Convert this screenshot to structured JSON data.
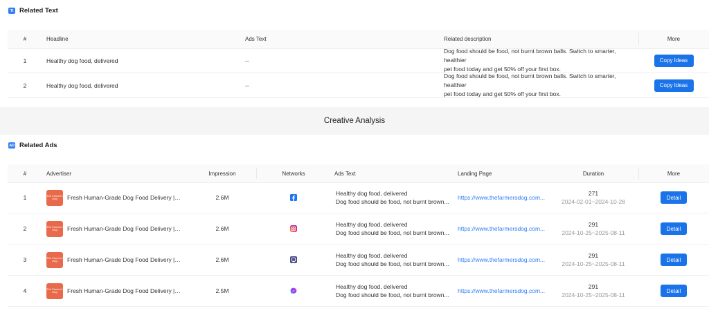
{
  "related_text": {
    "title": "Related Text",
    "badge": "Tt",
    "columns": [
      "#",
      "Headline",
      "Ads Text",
      "Related description",
      "More"
    ],
    "rows": [
      {
        "num": "1",
        "headline": "Healthy dog food, delivered",
        "ads_text": "--",
        "desc1": "Dog food should be food, not burnt brown balls. Switch to smarter, healthier",
        "desc2": "pet food today and get 50% off your first box.",
        "button": "Copy Ideas"
      },
      {
        "num": "2",
        "headline": "Healthy dog food, delivered",
        "ads_text": "--",
        "desc1": "Dog food should be food, not burnt brown balls. Switch to smarter, healthier",
        "desc2": "pet food today and get 50% off your first box.",
        "button": "Copy Ideas"
      }
    ]
  },
  "creative_analysis": {
    "title": "Creative Analysis"
  },
  "related_ads": {
    "title": "Related Ads",
    "badge": "AD",
    "columns": [
      "#",
      "Advertiser",
      "Impression",
      "Networks",
      "Ads Text",
      "Landing Page",
      "Duration",
      "More"
    ],
    "rows": [
      {
        "num": "1",
        "thumb": "The Farmer's Dog",
        "advertiser": "Fresh Human-Grade Dog Food Delivery | T...",
        "impression": "2.6M",
        "network": "facebook-icon",
        "ad1": "Healthy dog food, delivered",
        "ad2": "Dog food should be food, not burnt brown...",
        "landing": "https://www.thefarmersdog.com...",
        "duration": "271",
        "dates": "2024-02-01~2024-10-28",
        "button": "Detail"
      },
      {
        "num": "2",
        "thumb": "The Farmer's Dog",
        "advertiser": "Fresh Human-Grade Dog Food Delivery | T...",
        "impression": "2.6M",
        "network": "instagram-icon",
        "ad1": "Healthy dog food, delivered",
        "ad2": "Dog food should be food, not burnt brown...",
        "landing": "https://www.thefarmersdog.com...",
        "duration": "291",
        "dates": "2024-10-25~2025-08-11",
        "button": "Detail"
      },
      {
        "num": "3",
        "thumb": "The Farmer's Dog",
        "advertiser": "Fresh Human-Grade Dog Food Delivery | T...",
        "impression": "2.6M",
        "network": "audience-network-icon",
        "ad1": "Healthy dog food, delivered",
        "ad2": "Dog food should be food, not burnt brown...",
        "landing": "https://www.thefarmersdog.com...",
        "duration": "291",
        "dates": "2024-10-25~2025-08-11",
        "button": "Detail"
      },
      {
        "num": "4",
        "thumb": "The Farmer's Dog",
        "advertiser": "Fresh Human-Grade Dog Food Delivery | T...",
        "impression": "2.5M",
        "network": "messenger-icon",
        "ad1": "Healthy dog food, delivered",
        "ad2": "Dog food should be food, not burnt brown...",
        "landing": "https://www.thefarmersdog.com...",
        "duration": "291",
        "dates": "2024-10-25~2025-08-11",
        "button": "Detail"
      }
    ]
  },
  "colors": {
    "accent": "#1a73e8",
    "thumb": "#e86a4a",
    "link": "#2f7ef5"
  }
}
